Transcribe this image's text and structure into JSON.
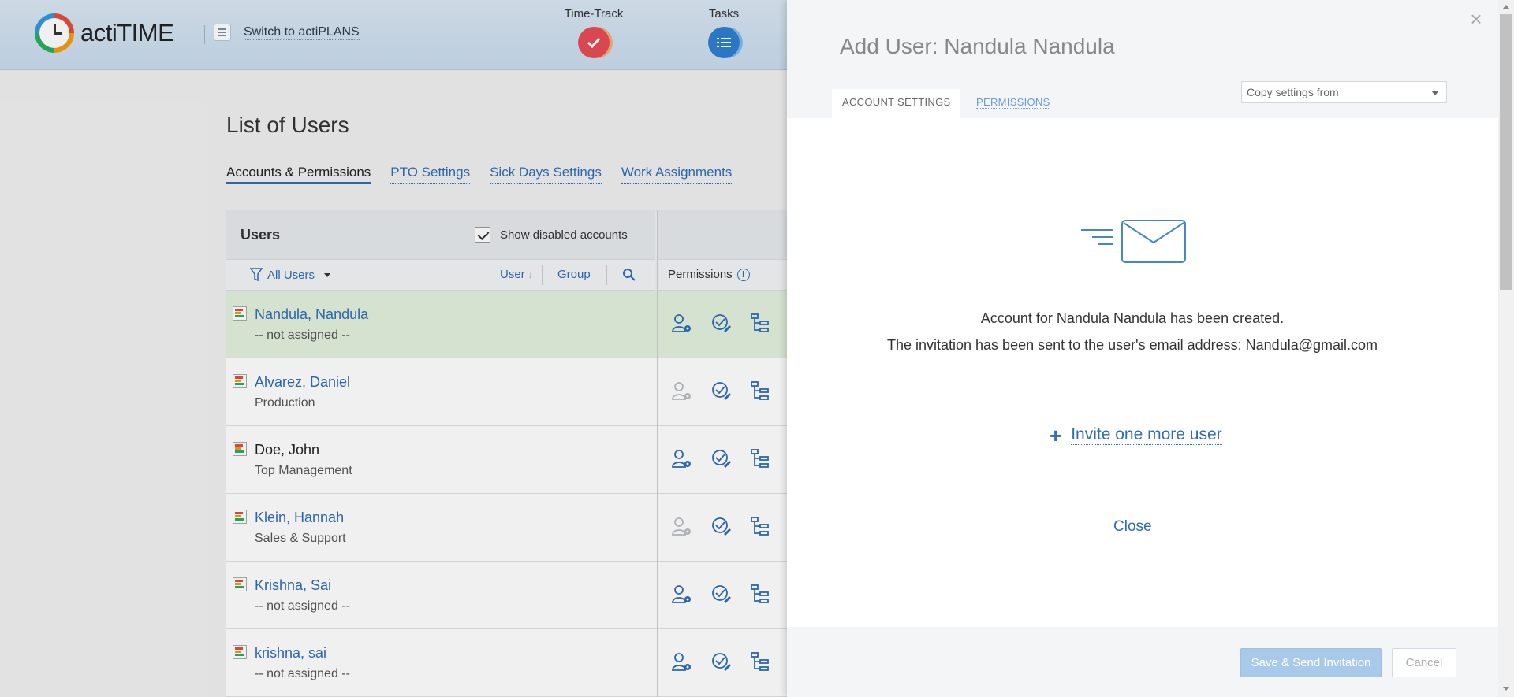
{
  "app": {
    "logo_text": "actiTIME",
    "switch_label": "Switch to actiPLANS",
    "nav": [
      {
        "label": "Time-Track",
        "color": "#e74c55",
        "icon": "check-icon"
      },
      {
        "label": "Tasks",
        "color": "#2f7fd1",
        "icon": "list-icon"
      }
    ]
  },
  "page": {
    "title": "List of Users",
    "subtabs": [
      "Accounts & Permissions",
      "PTO Settings",
      "Sick Days Settings",
      "Work Assignments"
    ]
  },
  "users_panel": {
    "title": "Users",
    "show_disabled_label": "Show disabled accounts",
    "filter_label": "All Users",
    "sort_user": "User",
    "sort_group": "Group",
    "permissions_label": "Permissions"
  },
  "users": [
    {
      "name": "Nandula, Nandula",
      "group": "-- not assigned --",
      "link": true,
      "selected": true,
      "manage_enabled": true
    },
    {
      "name": "Alvarez, Daniel",
      "group": "Production",
      "link": true,
      "selected": false,
      "manage_enabled": false
    },
    {
      "name": "Doe, John",
      "group": "Top Management",
      "link": false,
      "selected": false,
      "manage_enabled": true
    },
    {
      "name": "Klein, Hannah",
      "group": "Sales & Support",
      "link": true,
      "selected": false,
      "manage_enabled": false
    },
    {
      "name": "Krishna, Sai",
      "group": "-- not assigned --",
      "link": true,
      "selected": false,
      "manage_enabled": true
    },
    {
      "name": "krishna, sai",
      "group": "-- not assigned --",
      "link": true,
      "selected": false,
      "manage_enabled": true
    }
  ],
  "modal": {
    "title": "Add User: Nandula Nandula",
    "tab_account": "ACCOUNT SETTINGS",
    "tab_permissions": "PERMISSIONS",
    "copy_settings_placeholder": "Copy settings from",
    "message_created": "Account for Nandula Nandula has been created.",
    "message_invitation": "The invitation has been sent to the user's email address: Nandula@gmail.com",
    "invite_more": "Invite one more user",
    "close_link": "Close",
    "save_button": "Save & Send Invitation",
    "cancel_button": "Cancel"
  }
}
